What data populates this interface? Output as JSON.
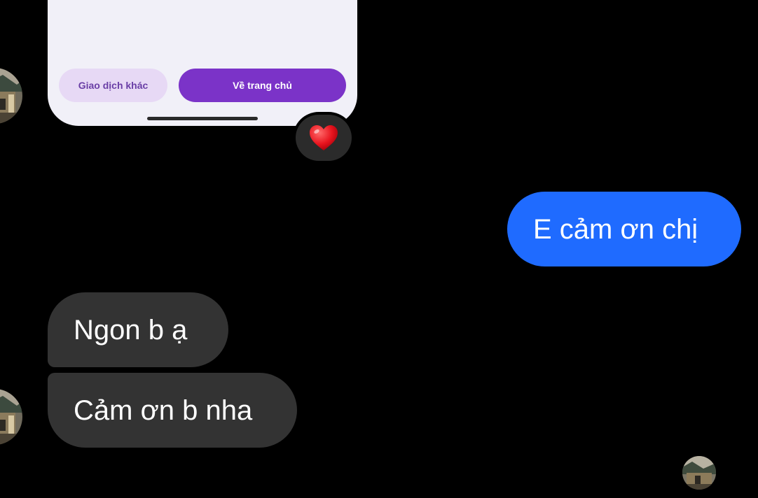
{
  "shared_image": {
    "secondary_button_label": "Giao dịch khác",
    "primary_button_label": "Về trang chủ",
    "colors": {
      "background": "#f1f0f8",
      "secondary_button": "#e7d9f5",
      "primary_button": "#7b33c8"
    }
  },
  "reaction": {
    "emoji": "❤️",
    "icon": "heart-icon"
  },
  "messages": [
    {
      "direction": "sent",
      "text": "E cảm ơn chị",
      "color": "#1f6bff"
    },
    {
      "direction": "received",
      "text": "Ngon b ạ",
      "color": "#333333"
    },
    {
      "direction": "received",
      "text": "Cảm ơn b nha",
      "color": "#333333"
    }
  ],
  "avatars": {
    "contact_icon": "contact-avatar",
    "read_receipt_icon": "read-receipt-avatar"
  }
}
